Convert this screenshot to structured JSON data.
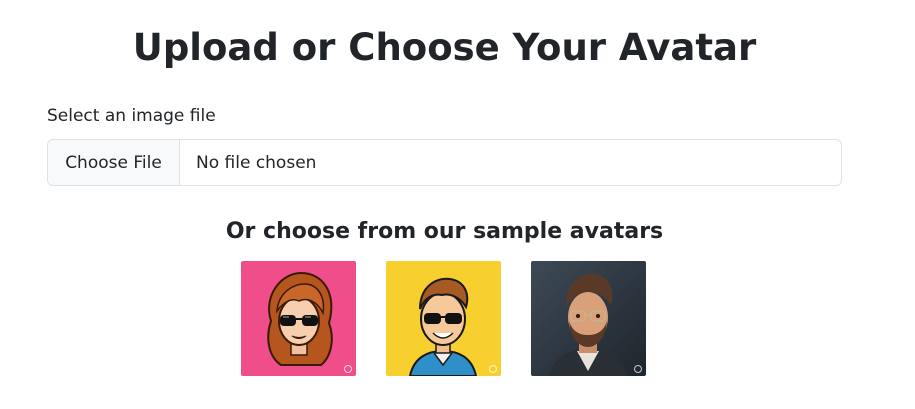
{
  "page": {
    "title": "Upload or Choose Your Avatar"
  },
  "upload": {
    "label": "Select an image file",
    "button_label": "Choose File",
    "status_text": "No file chosen"
  },
  "samples": {
    "heading": "Or choose from our sample avatars",
    "avatars": [
      {
        "name": "avatar-woman-sunglasses",
        "background": "#f04e8a"
      },
      {
        "name": "avatar-boy-sunglasses",
        "background": "#f7d02f"
      },
      {
        "name": "avatar-man-glasses",
        "background": "#2f3a45"
      }
    ]
  }
}
